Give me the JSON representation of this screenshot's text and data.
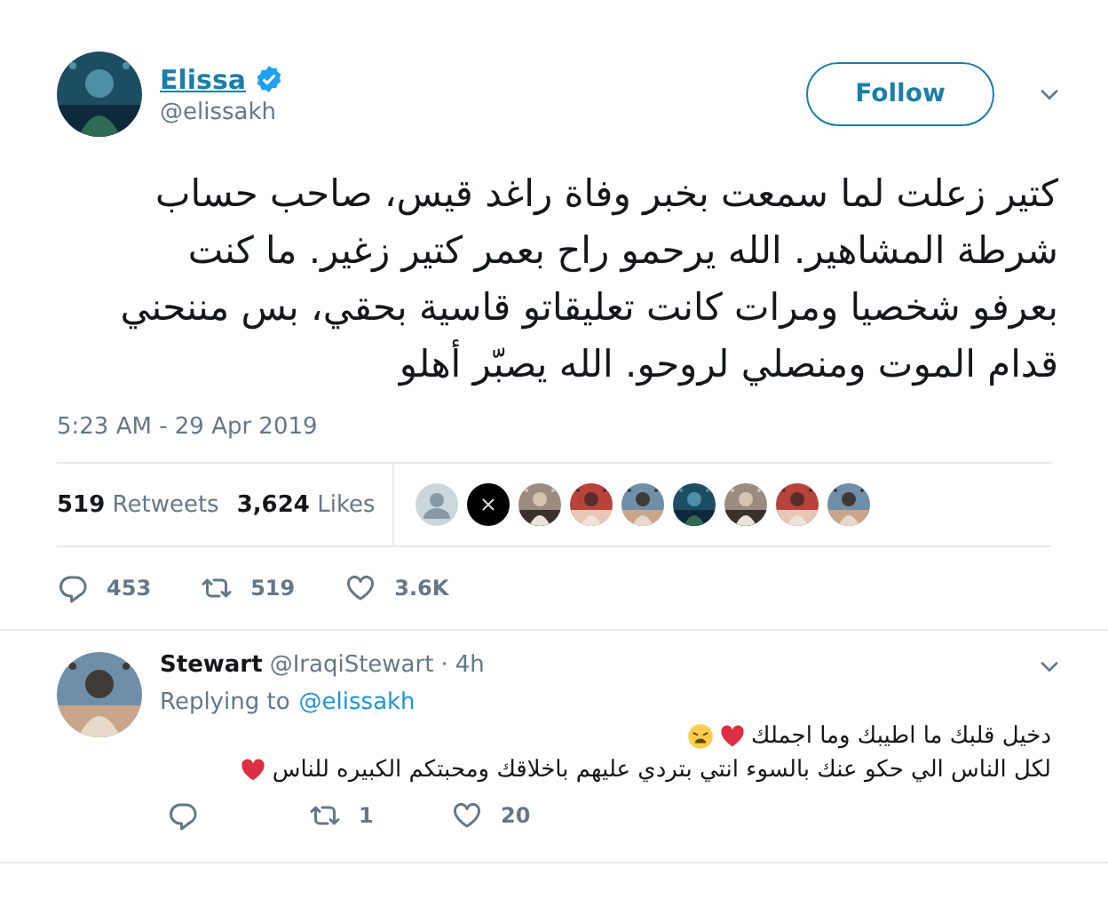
{
  "tweet": {
    "author": {
      "name": "Elissa",
      "verified": true,
      "handle": "@elissakh"
    },
    "follow_button": "Follow",
    "text": "كتير زعلت لما سمعت بخبر وفاة راغد قيس، صاحب حساب شرطة المشاهير. الله يرحمو راح بعمر كتير زغير. ما كنت بعرفو شخصيا ومرات كانت تعليقاتو قاسية بحقي، بس مننحني قدام الموت ومنصلي لروحو. الله يصبّر أهلو",
    "timestamp": "5:23 AM - 29 Apr 2019",
    "stats": [
      {
        "count": "519",
        "label": "Retweets"
      },
      {
        "count": "3,624",
        "label": "Likes"
      }
    ],
    "likers": [
      {
        "kind": "default"
      },
      {
        "kind": "x"
      },
      {
        "kind": "picture"
      },
      {
        "kind": "picture"
      },
      {
        "kind": "picture"
      },
      {
        "kind": "picture"
      },
      {
        "kind": "picture"
      },
      {
        "kind": "picture"
      },
      {
        "kind": "picture"
      }
    ],
    "actions": [
      {
        "kind": "reply",
        "count": "453"
      },
      {
        "kind": "retweet",
        "count": "519"
      },
      {
        "kind": "like",
        "count": "3.6K"
      }
    ]
  },
  "reply": {
    "author": {
      "name": "Stewart",
      "handle": "@IraqiStewart",
      "separator": "·",
      "time": "4h"
    },
    "replying_prefix": "Replying to",
    "replying_to": "@elissakh",
    "lines": [
      {
        "text": "دخيل قلبك ما اطيبك وما اجملك",
        "emoji": [
          {
            "kind": "heart"
          },
          {
            "kind": "weary"
          }
        ]
      },
      {
        "text": "لكل الناس الي حكو عنك بالسوء انتي بتردي عليهم  باخلاقك ومحبتكم الكبيره للناس",
        "emoji": [
          {
            "kind": "heart"
          }
        ]
      }
    ],
    "actions": [
      {
        "kind": "reply"
      },
      {
        "kind": "retweet",
        "count": "1"
      },
      {
        "kind": "like",
        "count": "20"
      }
    ]
  }
}
